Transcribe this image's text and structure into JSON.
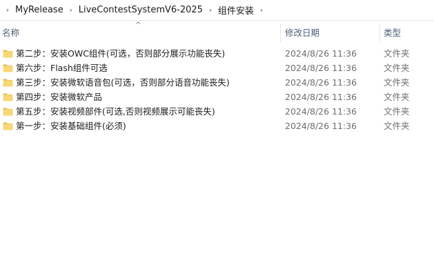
{
  "breadcrumb": {
    "items": [
      "MyRelease",
      "LiveContestSystemV6-2025",
      "组件安装"
    ]
  },
  "columns": {
    "name": "名称",
    "date": "修改日期",
    "type": "类型"
  },
  "files": [
    {
      "name": "第二步：安装OWC组件(可选，否则部分展示功能丧失)",
      "date": "2024/8/26 11:36",
      "type": "文件夹"
    },
    {
      "name": "第六步：Flash组件可选",
      "date": "2024/8/26 11:36",
      "type": "文件夹"
    },
    {
      "name": "第三步：安装微软语音包(可选，否则部分语音功能丧失)",
      "date": "2024/8/26 11:36",
      "type": "文件夹"
    },
    {
      "name": "第四步：安装微软产品",
      "date": "2024/8/26 11:36",
      "type": "文件夹"
    },
    {
      "name": "第五步：安装视频部件(可选,否则视频展示可能丧失)",
      "date": "2024/8/26 11:36",
      "type": "文件夹"
    },
    {
      "name": "第一步：安装基础组件(必须)",
      "date": "2024/8/26 11:36",
      "type": "文件夹"
    }
  ],
  "colors": {
    "folder_fill": "#f8d775",
    "folder_tab": "#e6b84a",
    "header_text": "#4c607a"
  }
}
